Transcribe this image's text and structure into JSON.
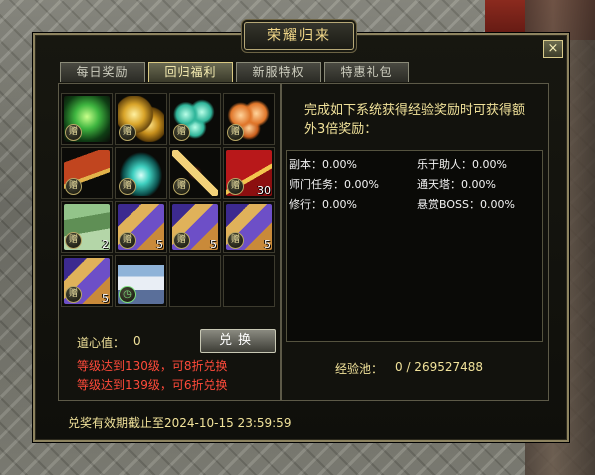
{
  "dialog": {
    "title": "荣耀归来",
    "close_label": "×"
  },
  "tabs": [
    {
      "label": "每日奖励"
    },
    {
      "label": "回归福利"
    },
    {
      "label": "新服特权"
    },
    {
      "label": "特惠礼包"
    }
  ],
  "items": [
    {
      "icon": "green-spirit-orb-icon",
      "badge": "赠",
      "count": ""
    },
    {
      "icon": "gold-coins-icon",
      "badge": "赠",
      "count": ""
    },
    {
      "icon": "jade-beads-icon",
      "badge": "赠",
      "count": ""
    },
    {
      "icon": "orange-fruits-icon",
      "badge": "赠",
      "count": ""
    },
    {
      "icon": "lantern-talisman-icon",
      "badge": "赠",
      "count": ""
    },
    {
      "icon": "azure-flame-icon",
      "badge": "赠",
      "count": ""
    },
    {
      "icon": "golden-dagger-icon",
      "badge": "赠",
      "count": ""
    },
    {
      "icon": "red-tome-icon",
      "badge": "赠",
      "count": "30"
    },
    {
      "icon": "banknotes-icon",
      "badge": "赠",
      "count": "2"
    },
    {
      "icon": "scroll-box-icon",
      "badge": "赠",
      "count": "5"
    },
    {
      "icon": "scroll-box-icon",
      "badge": "赠",
      "count": "5"
    },
    {
      "icon": "scroll-box-icon",
      "badge": "赠",
      "count": "5"
    },
    {
      "icon": "scroll-box-icon",
      "badge": "赠",
      "count": "5"
    },
    {
      "icon": "warrior-figure-icon",
      "badge": "clock",
      "count": ""
    }
  ],
  "left": {
    "dao_label": "道心值：",
    "dao_value": "0",
    "exchange_label": "兑换",
    "rule1": "等级达到130级，可8折兑换",
    "rule2": "等级达到139级，可6折兑换"
  },
  "right": {
    "info": "完成如下系统获得经验奖励时可获得额外3倍奖励：",
    "stats": [
      {
        "label": "副本：",
        "value": "0.00%"
      },
      {
        "label": "乐于助人：",
        "value": "0.00%"
      },
      {
        "label": "师门任务：",
        "value": "0.00%"
      },
      {
        "label": "通天塔：",
        "value": "0.00%"
      },
      {
        "label": "修行：",
        "value": "0.00%"
      },
      {
        "label": "悬赏BOSS：",
        "value": "0.00%"
      }
    ],
    "pool_label": "经验池：",
    "pool_value": "0 / 269527488"
  },
  "footer": {
    "expire_text": "兑奖有效期截止至2024-10-15 23:59:59"
  },
  "colors": {
    "gold_text": "#f1e29a",
    "warning_text": "#ff4a3a",
    "frame_gold": "#8e8460"
  }
}
